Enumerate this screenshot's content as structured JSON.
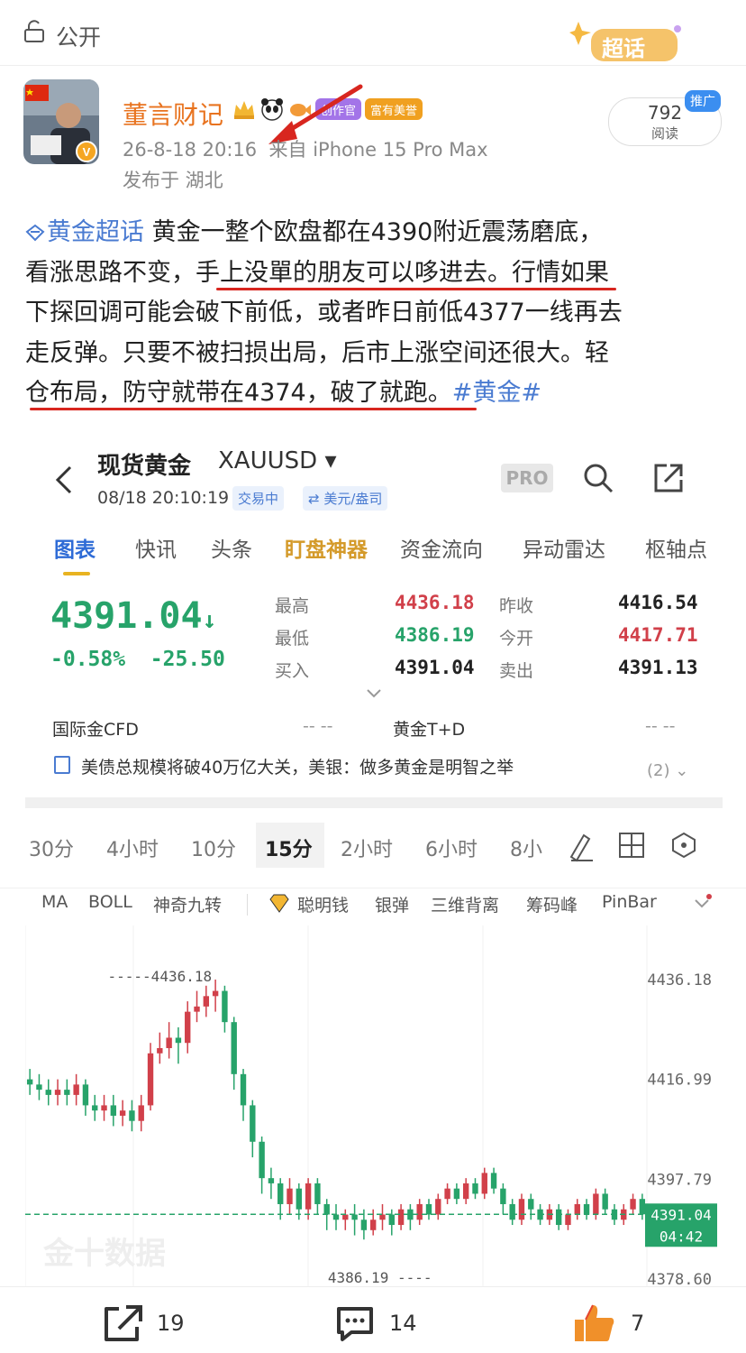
{
  "topbar": {
    "label": "公开",
    "super_topic_badge": "超话"
  },
  "post_header": {
    "username": "董言财记",
    "badges": [
      "创作官",
      "富有美誉"
    ],
    "timestamp": "26-8-18 20:16",
    "source": "来自 iPhone 15 Pro Max",
    "location": "发布于 湖北",
    "read_count": "792",
    "read_label": "阅读",
    "promo_tag": "推广"
  },
  "post": {
    "topic": "黄金超话",
    "line1": "黄金一整个欧盘都在4390附近震荡磨底，",
    "line2a": "看涨思路不变，",
    "line2b": "手上没單的朋友可以哆进去。",
    "line2c": "行情如果",
    "line3": "下探回调可能会破下前低，或者昨日前低4377一线再去",
    "line4": "走反弹。只要不被扫损出局，后市上涨空间还很大。轻",
    "line5a": "仓布局，防守就带在4374，破了就跑。",
    "hashtag": "#黄金#"
  },
  "app": {
    "title": "现货黄金",
    "symbol": "XAUUSD ▾",
    "datetime": "08/18 20:10:19",
    "status": "交易中",
    "unit": "⇄ 美元/盎司",
    "pro_label": "PRO",
    "tabs": [
      "图表",
      "快讯",
      "头条",
      "盯盘神器",
      "资金流向",
      "异动雷达",
      "枢轴点"
    ],
    "price": "4391.04",
    "price_arrow": "↓",
    "change_pct": "-0.58%",
    "change_abs": "-25.50",
    "quote": {
      "high_label": "最高",
      "high": "4436.18",
      "low_label": "最低",
      "low": "4386.19",
      "bid_label": "买入",
      "bid": "4391.04",
      "prev_close_label": "昨收",
      "prev_close": "4416.54",
      "open_label": "今开",
      "open": "4417.71",
      "ask_label": "卖出",
      "ask": "4391.13"
    },
    "related": [
      {
        "name": "国际金CFD",
        "value": "-- --"
      },
      {
        "name": "黄金T+D",
        "value": "-- --"
      }
    ],
    "news": "美债总规模将破40万亿大关，美银：做多黄金是明智之举",
    "news_count": "(2) ⌄",
    "intervals": [
      "30分",
      "4小时",
      "10分",
      "15分",
      "2小时",
      "6小时",
      "8小"
    ],
    "active_interval": "15分",
    "indicators": [
      "MA",
      "BOLL",
      "神奇九转",
      "聪明钱",
      "银弹",
      "三维背离",
      "筹码峰",
      "PinBar"
    ],
    "watermark": "金十数据"
  },
  "chart_data": {
    "type": "candlestick",
    "y_axis_labels": [
      "4436.18",
      "4416.99",
      "4397.79",
      "4378.60"
    ],
    "ylim": [
      4378.6,
      4436.18
    ],
    "high_marker": "4436.18",
    "low_marker": "4386.19",
    "last_price": "4391.04",
    "countdown": "04:42",
    "up_color": "#d1404a",
    "down_color": "#27a36a",
    "candles": [
      [
        4417,
        4416,
        4419,
        4414
      ],
      [
        4416,
        4415,
        4418,
        4413
      ],
      [
        4415,
        4414,
        4417,
        4412
      ],
      [
        4414,
        4415,
        4417,
        4412
      ],
      [
        4415,
        4414,
        4417,
        4412
      ],
      [
        4414,
        4416,
        4418,
        4412
      ],
      [
        4416,
        4412,
        4417,
        4410
      ],
      [
        4412,
        4411,
        4414,
        4409
      ],
      [
        4411,
        4412,
        4414,
        4409
      ],
      [
        4412,
        4410,
        4414,
        4408
      ],
      [
        4410,
        4411,
        4413,
        4408
      ],
      [
        4411,
        4409,
        4413,
        4407
      ],
      [
        4409,
        4412,
        4414,
        4407
      ],
      [
        4412,
        4422,
        4424,
        4411
      ],
      [
        4422,
        4423,
        4426,
        4420
      ],
      [
        4423,
        4425,
        4428,
        4421
      ],
      [
        4425,
        4424,
        4427,
        4420
      ],
      [
        4424,
        4430,
        4432,
        4422
      ],
      [
        4430,
        4431,
        4434,
        4428
      ],
      [
        4431,
        4433,
        4435,
        4429
      ],
      [
        4433,
        4434,
        4436.18,
        4430
      ],
      [
        4434,
        4428,
        4435,
        4426
      ],
      [
        4428,
        4418,
        4429,
        4415
      ],
      [
        4418,
        4412,
        4419,
        4409
      ],
      [
        4412,
        4405,
        4413,
        4402
      ],
      [
        4405,
        4398,
        4406,
        4395
      ],
      [
        4398,
        4397,
        4400,
        4394
      ],
      [
        4397,
        4393,
        4398,
        4390
      ],
      [
        4393,
        4396,
        4398,
        4391
      ],
      [
        4396,
        4392,
        4397,
        4390
      ],
      [
        4392,
        4397,
        4398,
        4390
      ],
      [
        4397,
        4393,
        4398,
        4391
      ],
      [
        4393,
        4391,
        4394,
        4388
      ],
      [
        4391,
        4390,
        4393,
        4388
      ],
      [
        4390,
        4391,
        4392,
        4388
      ],
      [
        4391,
        4390,
        4393,
        4387
      ],
      [
        4390,
        4388,
        4392,
        4386.19
      ],
      [
        4388,
        4390,
        4392,
        4387
      ],
      [
        4390,
        4391,
        4393,
        4388
      ],
      [
        4391,
        4389,
        4392,
        4387
      ],
      [
        4389,
        4392,
        4393,
        4388
      ],
      [
        4392,
        4390,
        4393,
        4388
      ],
      [
        4390,
        4393,
        4394,
        4389
      ],
      [
        4393,
        4391,
        4394,
        4390
      ],
      [
        4391,
        4394,
        4395,
        4390
      ],
      [
        4394,
        4396,
        4397,
        4393
      ],
      [
        4396,
        4394,
        4397,
        4393
      ],
      [
        4394,
        4397,
        4398,
        4393
      ],
      [
        4397,
        4395,
        4398,
        4394
      ],
      [
        4395,
        4399,
        4400,
        4394
      ],
      [
        4399,
        4396,
        4400,
        4395
      ],
      [
        4396,
        4393,
        4397,
        4391
      ],
      [
        4393,
        4390,
        4394,
        4389
      ],
      [
        4390,
        4394,
        4395,
        4389
      ],
      [
        4394,
        4392,
        4395,
        4390
      ],
      [
        4392,
        4390,
        4393,
        4389
      ],
      [
        4390,
        4392,
        4393,
        4389
      ],
      [
        4392,
        4389,
        4393,
        4388
      ],
      [
        4389,
        4391,
        4392,
        4388
      ],
      [
        4391,
        4393,
        4394,
        4390
      ],
      [
        4393,
        4391,
        4394,
        4390
      ],
      [
        4391,
        4395,
        4396,
        4390
      ],
      [
        4395,
        4392,
        4396,
        4391
      ],
      [
        4392,
        4390,
        4393,
        4389
      ],
      [
        4390,
        4392,
        4393,
        4389
      ],
      [
        4392,
        4394,
        4395,
        4391
      ],
      [
        4394,
        4391.04,
        4395,
        4390
      ]
    ]
  },
  "actions": {
    "share_count": "19",
    "comment_count": "14",
    "like_count": "7"
  }
}
